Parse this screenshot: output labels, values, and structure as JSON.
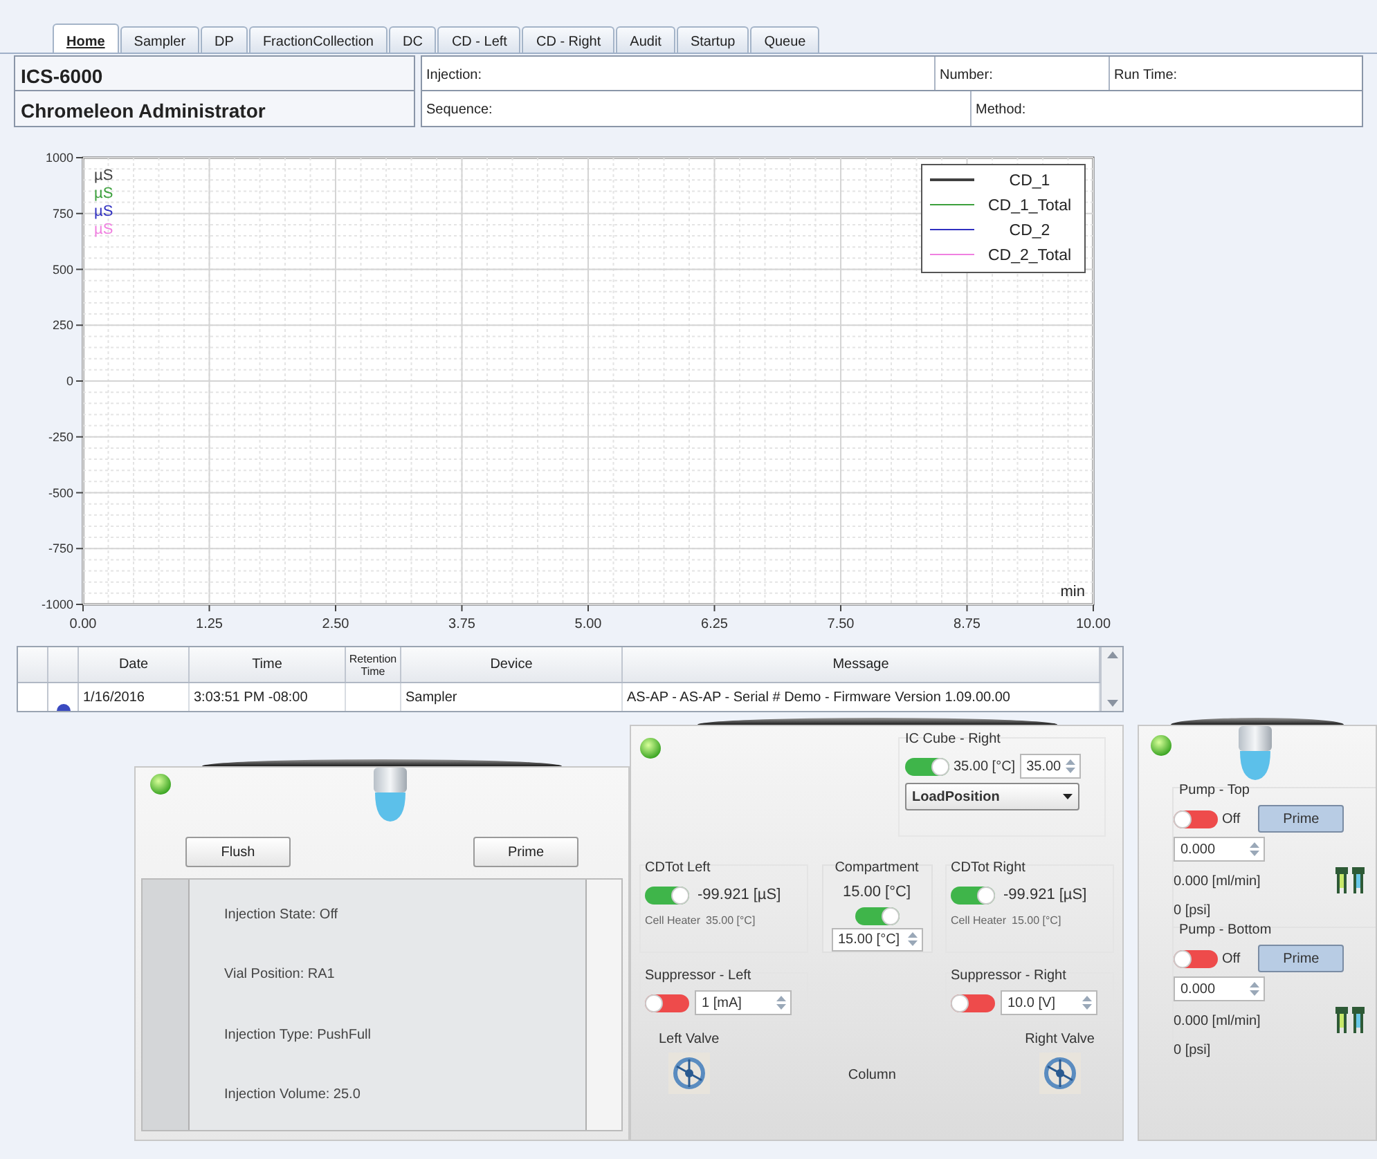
{
  "tabs": [
    {
      "label": "Home",
      "selected": true
    },
    {
      "label": "Sampler",
      "selected": false
    },
    {
      "label": "DP",
      "selected": false
    },
    {
      "label": "FractionCollection",
      "selected": false
    },
    {
      "label": "DC",
      "selected": false
    },
    {
      "label": "CD - Left",
      "selected": false
    },
    {
      "label": "CD - Right",
      "selected": false
    },
    {
      "label": "Audit",
      "selected": false
    },
    {
      "label": "Startup",
      "selected": false
    },
    {
      "label": "Queue",
      "selected": false
    }
  ],
  "header": {
    "instrument": "ICS-6000",
    "user": "Chromeleon Administrator",
    "row_1": [
      {
        "label": "Injection:"
      },
      {
        "label": "Number:"
      },
      {
        "label": "Run Time:"
      }
    ],
    "row_2": [
      {
        "label": "Sequence:"
      },
      {
        "label": "Method:"
      }
    ]
  },
  "chart": {
    "x_unit": "min",
    "unit_labels": [
      {
        "text": "µS",
        "color": "#404040"
      },
      {
        "text": "µS",
        "color": "#3ca03c"
      },
      {
        "text": "µS",
        "color": "#3030c0"
      },
      {
        "text": "µS",
        "color": "#f080e0"
      }
    ],
    "chart_data": {
      "type": "line",
      "grid": true,
      "ylim": [
        -1000,
        1000
      ],
      "categories": [
        "0.00",
        "1.25",
        "2.50",
        "3.75",
        "5.00",
        "6.25",
        "7.50",
        "8.75",
        "10.00"
      ],
      "yticks": [
        1000,
        750,
        500,
        250,
        0,
        -250,
        -500,
        -750,
        -1000
      ],
      "series": [
        {
          "name": "CD_1",
          "color": "#404040",
          "values": [
            null,
            null,
            null,
            null,
            null,
            null,
            null,
            null,
            null
          ]
        },
        {
          "name": "CD_1_Total",
          "color": "#3ca03c",
          "values": [
            null,
            null,
            null,
            null,
            null,
            null,
            null,
            null,
            null
          ]
        },
        {
          "name": "CD_2",
          "color": "#3030c0",
          "values": [
            null,
            null,
            null,
            null,
            null,
            null,
            null,
            null,
            null
          ]
        },
        {
          "name": "CD_2_Total",
          "color": "#f080e0",
          "values": [
            null,
            null,
            null,
            null,
            null,
            null,
            null,
            null,
            null
          ]
        }
      ]
    }
  },
  "audit_table": {
    "columns": [
      "Date",
      "Time",
      "Retention Time",
      "Device",
      "Message"
    ],
    "rows": [
      {
        "date": "1/16/2016",
        "time": "3:03:51 PM -08:00",
        "device": "Sampler",
        "message": "AS-AP - AS-AP - Serial # Demo - Firmware Version 1.09.00.00"
      }
    ]
  },
  "sampler_panel": {
    "ready": true,
    "buttons": [
      "Flush",
      "Prime"
    ],
    "lines": [
      "Injection State: Off",
      "Vial Position: RA1",
      "Injection Type: PushFull",
      "Injection Volume: 25.0"
    ]
  },
  "center_panel": {
    "ready": true,
    "ic_cube": {
      "title": "IC Cube - Right",
      "on": true,
      "reading": "35.00 [°C]",
      "setpoint": "35.00",
      "valve_position": "LoadPosition"
    },
    "cdtot_left": {
      "title": "CDTot Left",
      "on": true,
      "reading": "-99.921 [µS]",
      "heater_label": "Cell Heater",
      "heater_value": "35.00 [°C]"
    },
    "compartment": {
      "title": "Compartment",
      "reading": "15.00 [°C]",
      "on": true,
      "setpoint": "15.00 [°C]"
    },
    "cdtot_right": {
      "title": "CDTot Right",
      "on": true,
      "reading": "-99.921 [µS]",
      "heater_label": "Cell Heater",
      "heater_value": "15.00 [°C]"
    },
    "suppressor_left": {
      "title": "Suppressor - Left",
      "on": false,
      "value": "1 [mA]"
    },
    "suppressor_right": {
      "title": "Suppressor - Right",
      "on": false,
      "value": "10.0 [V]"
    },
    "left_valve": "Left Valve",
    "column": "Column",
    "right_valve": "Right Valve"
  },
  "pump_panel": {
    "ready": true,
    "pumps": [
      {
        "title": "Pump - Top",
        "on": false,
        "state_text": "Off",
        "button": "Prime",
        "flow_setting": "0.000",
        "flow": "0.000 [ml/min]",
        "pressure": "0 [psi]"
      },
      {
        "title": "Pump - Bottom",
        "on": false,
        "state_text": "Off",
        "button": "Prime",
        "flow_setting": "0.000",
        "flow": "0.000 [ml/min]",
        "pressure": "0 [psi]"
      }
    ]
  }
}
